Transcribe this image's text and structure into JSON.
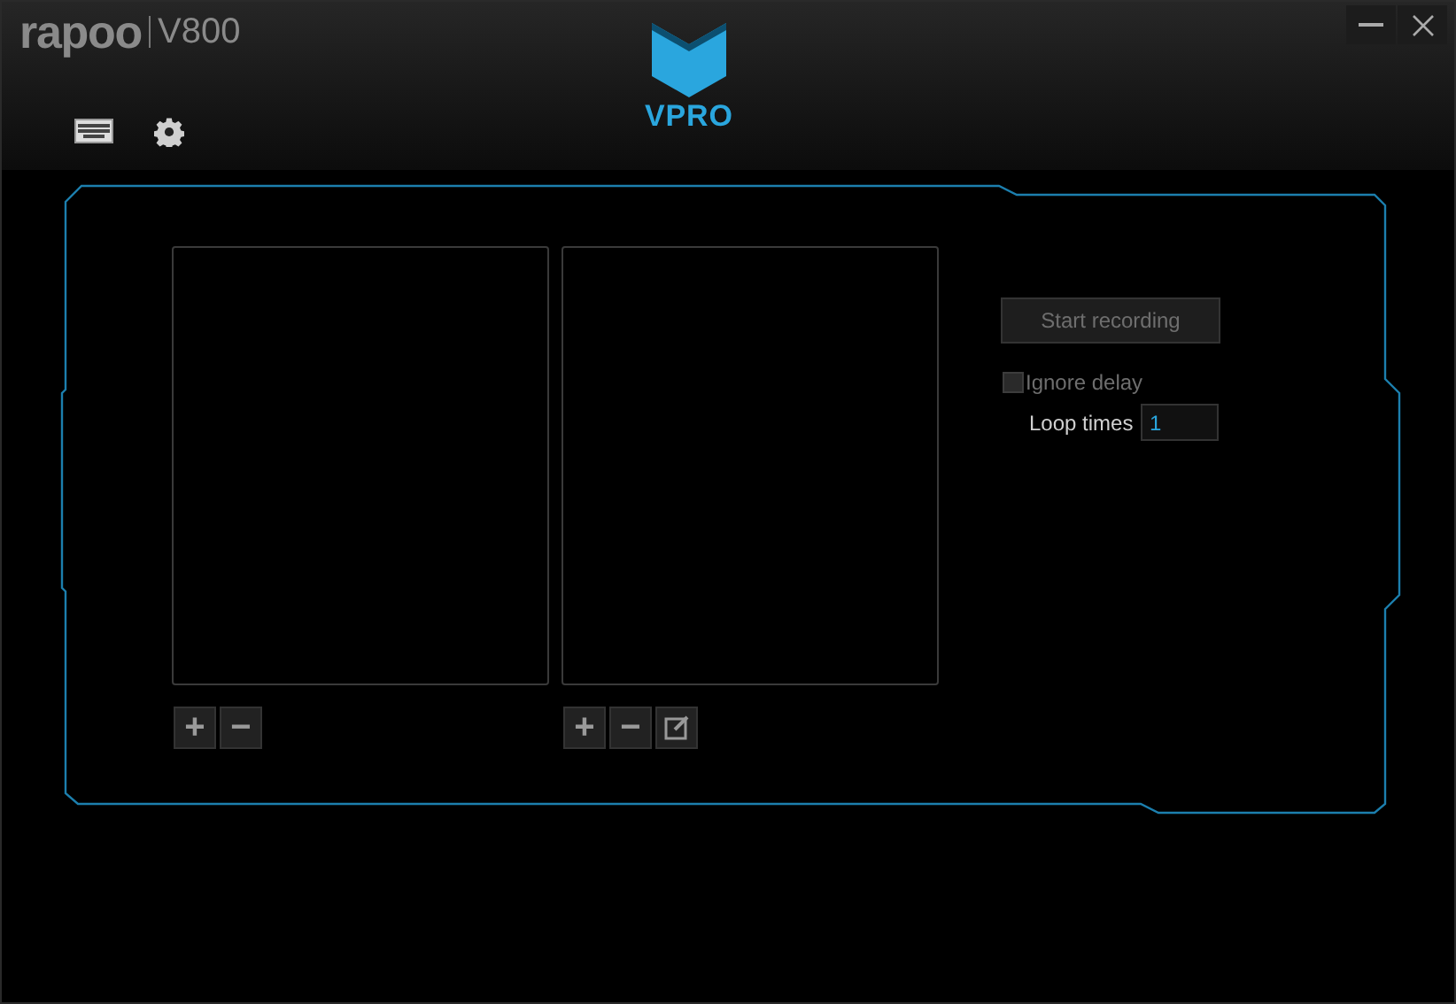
{
  "header": {
    "brand": "rapoo",
    "model": "V800",
    "logo_text": "VPRO"
  },
  "macro_lists": [
    {
      "buttons": [
        "+",
        "−"
      ],
      "edit": false
    },
    {
      "buttons": [
        "+",
        "−"
      ],
      "edit": true
    }
  ],
  "record_button": "Start recording",
  "ignore_delay": {
    "label": "Ignore delay",
    "checked": false
  },
  "loop_times": {
    "label": "Loop times",
    "value": "1"
  }
}
